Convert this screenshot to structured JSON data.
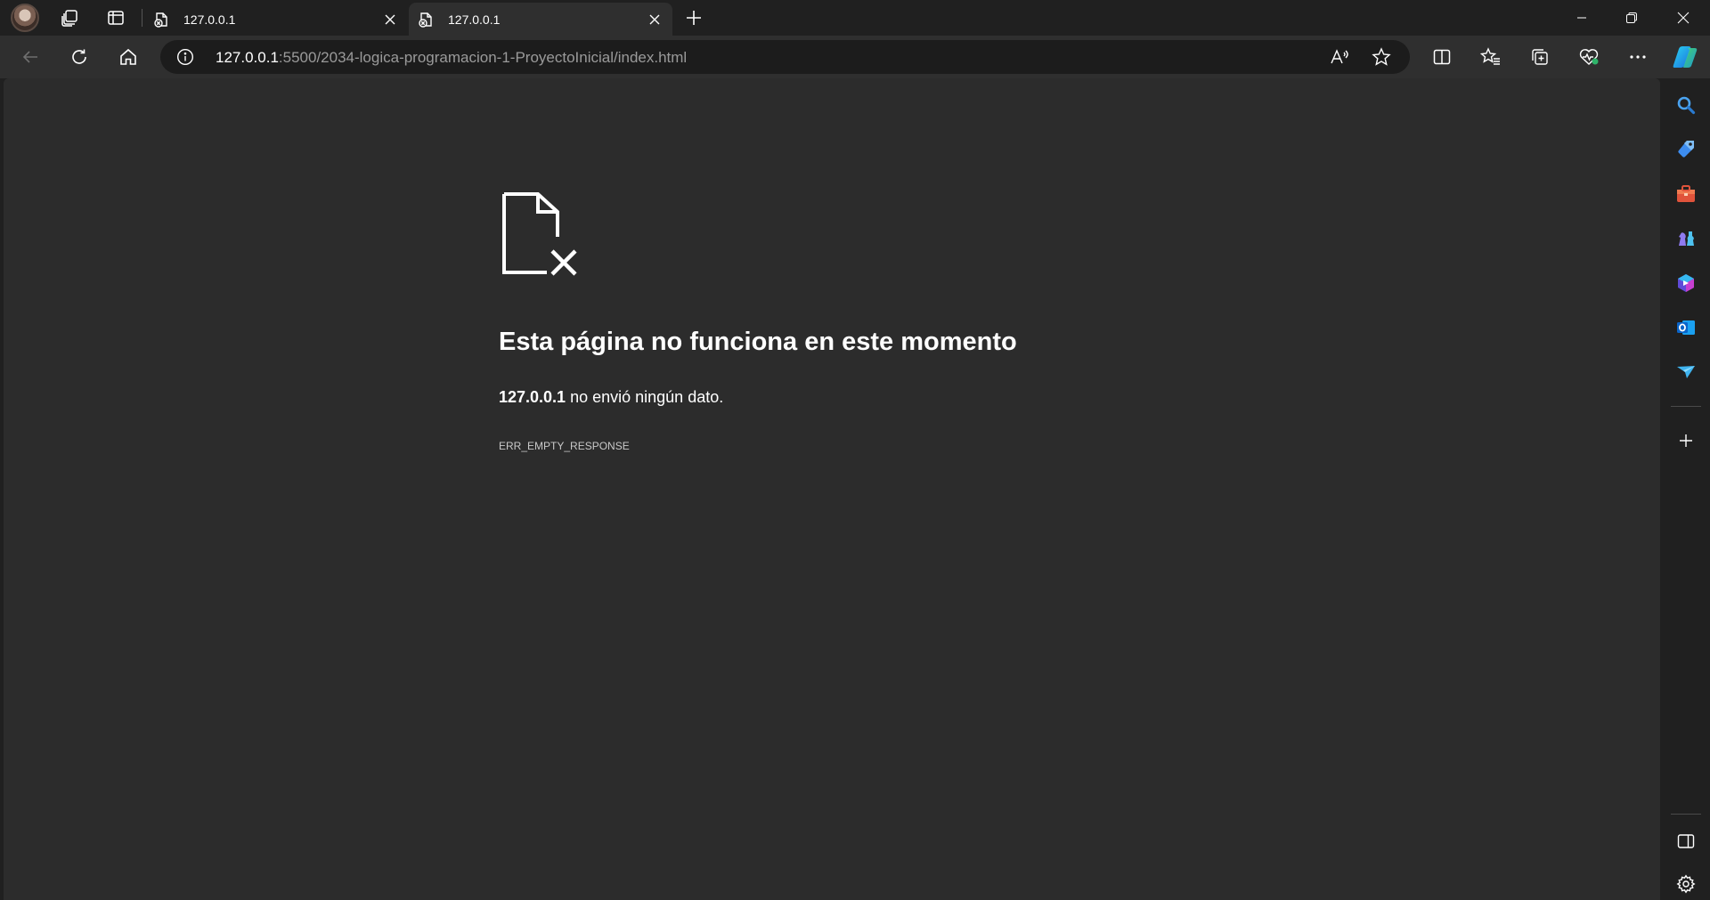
{
  "tabs": [
    {
      "title": "127.0.0.1",
      "icon": "error-page-icon",
      "active": false
    },
    {
      "title": "127.0.0.1",
      "icon": "error-page-icon",
      "active": true
    }
  ],
  "address_bar": {
    "host": "127.0.0.1",
    "path": ":5500/2034-logica-programacion-1-ProyectoInicial/index.html"
  },
  "error_page": {
    "title": "Esta página no funciona en este momento",
    "host": "127.0.0.1",
    "message": " no envió ningún dato.",
    "code": "ERR_EMPTY_RESPONSE"
  },
  "colors": {
    "chrome_bg": "#202020",
    "toolbar_bg": "#2f2f2f",
    "page_bg": "#2c2c2c",
    "text": "#ffffff"
  }
}
